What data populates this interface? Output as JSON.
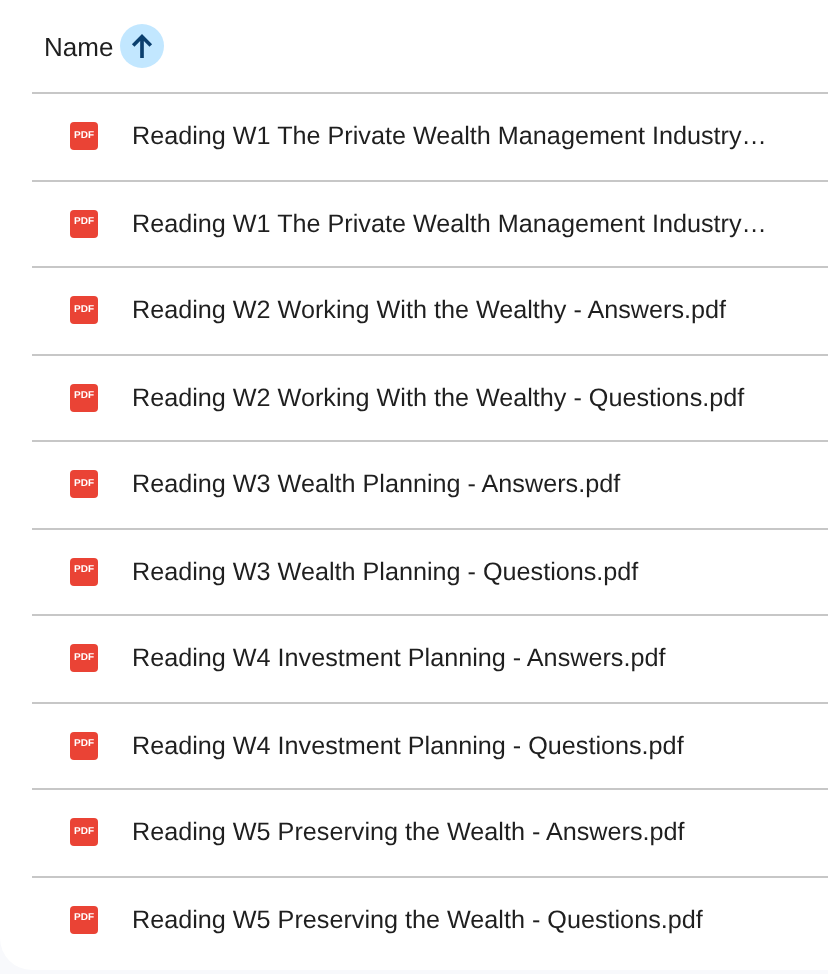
{
  "header": {
    "label": "Name",
    "sort_ascending": true
  },
  "files": [
    {
      "icon_text": "PDF",
      "name": "Reading W1 The Private Wealth Management Industry…"
    },
    {
      "icon_text": "PDF",
      "name": "Reading W1 The Private Wealth Management Industry…"
    },
    {
      "icon_text": "PDF",
      "name": "Reading W2 Working With the Wealthy - Answers.pdf"
    },
    {
      "icon_text": "PDF",
      "name": "Reading W2 Working With the Wealthy - Questions.pdf"
    },
    {
      "icon_text": "PDF",
      "name": "Reading W3 Wealth Planning - Answers.pdf"
    },
    {
      "icon_text": "PDF",
      "name": "Reading W3 Wealth Planning - Questions.pdf"
    },
    {
      "icon_text": "PDF",
      "name": "Reading W4 Investment Planning - Answers.pdf"
    },
    {
      "icon_text": "PDF",
      "name": "Reading W4 Investment Planning - Questions.pdf"
    },
    {
      "icon_text": "PDF",
      "name": "Reading W5 Preserving the Wealth - Answers.pdf"
    },
    {
      "icon_text": "PDF",
      "name": "Reading W5 Preserving the Wealth - Questions.pdf"
    }
  ]
}
